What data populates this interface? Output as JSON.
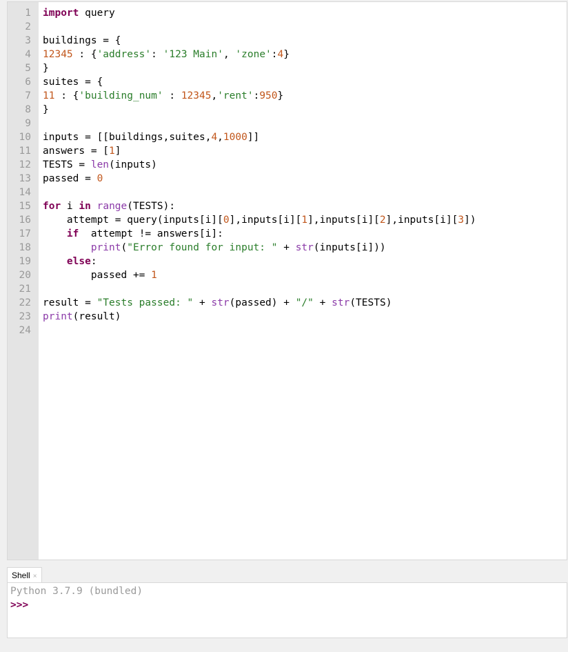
{
  "editor": {
    "lines": [
      {
        "n": "1",
        "tokens": [
          {
            "t": "import",
            "c": "kw"
          },
          {
            "t": " query",
            "c": ""
          }
        ]
      },
      {
        "n": "2",
        "tokens": []
      },
      {
        "n": "3",
        "tokens": [
          {
            "t": "buildings = {",
            "c": ""
          }
        ]
      },
      {
        "n": "4",
        "tokens": [
          {
            "t": "12345",
            "c": "num"
          },
          {
            "t": " : {",
            "c": ""
          },
          {
            "t": "'address'",
            "c": "str"
          },
          {
            "t": ": ",
            "c": ""
          },
          {
            "t": "'123 Main'",
            "c": "str"
          },
          {
            "t": ", ",
            "c": ""
          },
          {
            "t": "'zone'",
            "c": "str"
          },
          {
            "t": ":",
            "c": ""
          },
          {
            "t": "4",
            "c": "num"
          },
          {
            "t": "}",
            "c": ""
          }
        ]
      },
      {
        "n": "5",
        "tokens": [
          {
            "t": "}",
            "c": ""
          }
        ]
      },
      {
        "n": "6",
        "tokens": [
          {
            "t": "suites = {",
            "c": ""
          }
        ]
      },
      {
        "n": "7",
        "tokens": [
          {
            "t": "11",
            "c": "num"
          },
          {
            "t": " : {",
            "c": ""
          },
          {
            "t": "'building_num'",
            "c": "str"
          },
          {
            "t": " : ",
            "c": ""
          },
          {
            "t": "12345",
            "c": "num"
          },
          {
            "t": ",",
            "c": ""
          },
          {
            "t": "'rent'",
            "c": "str"
          },
          {
            "t": ":",
            "c": ""
          },
          {
            "t": "950",
            "c": "num"
          },
          {
            "t": "}",
            "c": ""
          }
        ]
      },
      {
        "n": "8",
        "tokens": [
          {
            "t": "}",
            "c": ""
          }
        ]
      },
      {
        "n": "9",
        "tokens": []
      },
      {
        "n": "10",
        "tokens": [
          {
            "t": "inputs = [[buildings,suites,",
            "c": ""
          },
          {
            "t": "4",
            "c": "num"
          },
          {
            "t": ",",
            "c": ""
          },
          {
            "t": "1000",
            "c": "num"
          },
          {
            "t": "]]",
            "c": ""
          }
        ]
      },
      {
        "n": "11",
        "tokens": [
          {
            "t": "answers = [",
            "c": ""
          },
          {
            "t": "1",
            "c": "num"
          },
          {
            "t": "]",
            "c": ""
          }
        ]
      },
      {
        "n": "12",
        "tokens": [
          {
            "t": "TESTS = ",
            "c": ""
          },
          {
            "t": "len",
            "c": "bi"
          },
          {
            "t": "(inputs)",
            "c": ""
          }
        ]
      },
      {
        "n": "13",
        "tokens": [
          {
            "t": "passed = ",
            "c": ""
          },
          {
            "t": "0",
            "c": "num"
          }
        ]
      },
      {
        "n": "14",
        "tokens": []
      },
      {
        "n": "15",
        "tokens": [
          {
            "t": "for",
            "c": "kw"
          },
          {
            "t": " i ",
            "c": ""
          },
          {
            "t": "in",
            "c": "kw"
          },
          {
            "t": " ",
            "c": ""
          },
          {
            "t": "range",
            "c": "bi"
          },
          {
            "t": "(TESTS):",
            "c": ""
          }
        ]
      },
      {
        "n": "16",
        "tokens": [
          {
            "t": "    attempt = query(inputs[i][",
            "c": ""
          },
          {
            "t": "0",
            "c": "num"
          },
          {
            "t": "],inputs[i][",
            "c": ""
          },
          {
            "t": "1",
            "c": "num"
          },
          {
            "t": "],inputs[i][",
            "c": ""
          },
          {
            "t": "2",
            "c": "num"
          },
          {
            "t": "],inputs[i][",
            "c": ""
          },
          {
            "t": "3",
            "c": "num"
          },
          {
            "t": "])",
            "c": ""
          }
        ]
      },
      {
        "n": "17",
        "tokens": [
          {
            "t": "    ",
            "c": ""
          },
          {
            "t": "if",
            "c": "kw"
          },
          {
            "t": "  attempt != answers[i]:",
            "c": ""
          }
        ]
      },
      {
        "n": "18",
        "tokens": [
          {
            "t": "        ",
            "c": ""
          },
          {
            "t": "print",
            "c": "bi"
          },
          {
            "t": "(",
            "c": ""
          },
          {
            "t": "\"Error found for input: \"",
            "c": "str"
          },
          {
            "t": " + ",
            "c": ""
          },
          {
            "t": "str",
            "c": "bi"
          },
          {
            "t": "(inputs[i]))",
            "c": ""
          }
        ]
      },
      {
        "n": "19",
        "tokens": [
          {
            "t": "    ",
            "c": ""
          },
          {
            "t": "else",
            "c": "kw"
          },
          {
            "t": ":",
            "c": ""
          }
        ]
      },
      {
        "n": "20",
        "tokens": [
          {
            "t": "        passed += ",
            "c": ""
          },
          {
            "t": "1",
            "c": "num"
          }
        ]
      },
      {
        "n": "21",
        "tokens": []
      },
      {
        "n": "22",
        "tokens": [
          {
            "t": "result = ",
            "c": ""
          },
          {
            "t": "\"Tests passed: \"",
            "c": "str"
          },
          {
            "t": " + ",
            "c": ""
          },
          {
            "t": "str",
            "c": "bi"
          },
          {
            "t": "(passed) + ",
            "c": ""
          },
          {
            "t": "\"/\"",
            "c": "str"
          },
          {
            "t": " + ",
            "c": ""
          },
          {
            "t": "str",
            "c": "bi"
          },
          {
            "t": "(TESTS)",
            "c": ""
          }
        ]
      },
      {
        "n": "23",
        "tokens": [
          {
            "t": "print",
            "c": "bi"
          },
          {
            "t": "(result)",
            "c": ""
          }
        ]
      },
      {
        "n": "24",
        "tokens": []
      }
    ]
  },
  "shell": {
    "tab_label": "Shell",
    "tab_close": "×",
    "banner": "Python 3.7.9 (bundled)",
    "prompt": ">>>",
    "input_value": ""
  },
  "colors": {
    "keyword": "#7f0055",
    "string": "#2a7d2a",
    "number": "#c1561b",
    "builtin": "#8b3aa8",
    "gutter": "#e4e4e4"
  }
}
